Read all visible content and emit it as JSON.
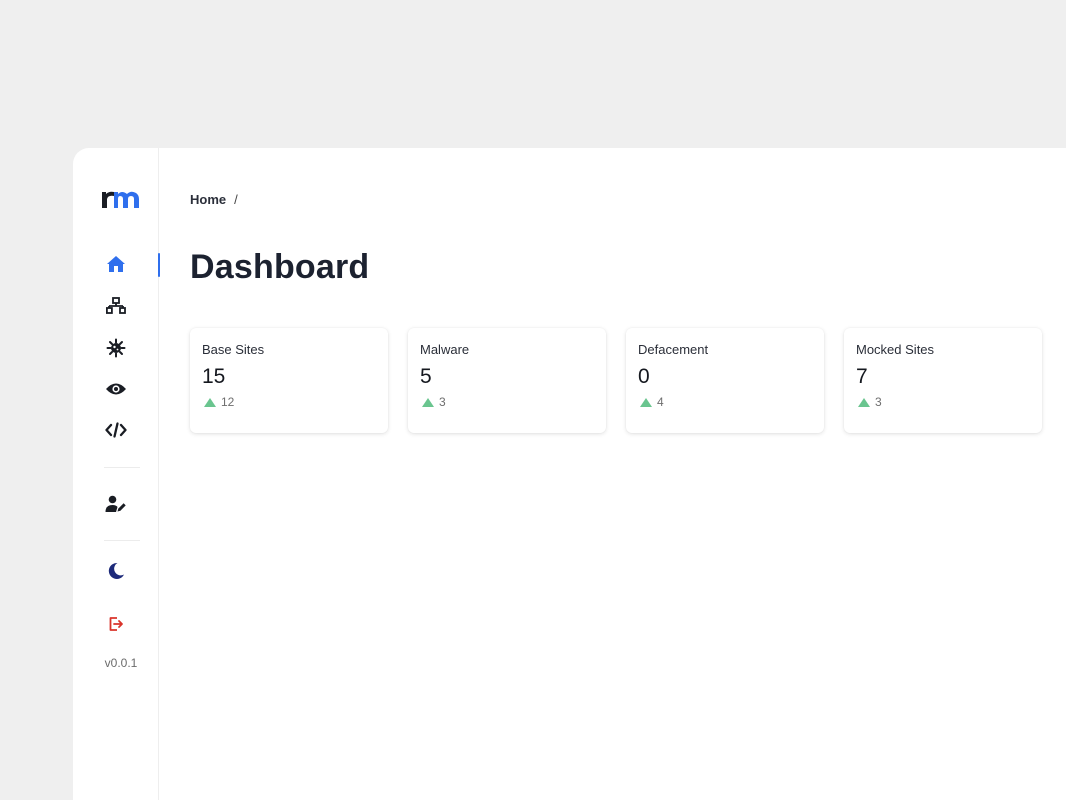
{
  "app": {
    "logo_text": "rm",
    "version": "v0.0.1"
  },
  "sidebar": {
    "items": [
      {
        "id": "home",
        "icon": "home-icon",
        "active": true
      },
      {
        "id": "network",
        "icon": "sitemap-icon",
        "active": false
      },
      {
        "id": "malware",
        "icon": "virus-icon",
        "active": false
      },
      {
        "id": "monitor",
        "icon": "eye-icon",
        "active": false
      },
      {
        "id": "code",
        "icon": "code-icon",
        "active": false
      },
      {
        "id": "user-edit",
        "icon": "user-edit-icon",
        "active": false
      },
      {
        "id": "theme",
        "icon": "moon-icon",
        "active": false
      },
      {
        "id": "logout",
        "icon": "logout-icon",
        "active": false
      }
    ]
  },
  "breadcrumb": {
    "items": [
      "Home"
    ],
    "separator": "/"
  },
  "page": {
    "title": "Dashboard"
  },
  "stats": [
    {
      "title": "Base Sites",
      "value": "15",
      "trend": "12"
    },
    {
      "title": "Malware",
      "value": "5",
      "trend": "3"
    },
    {
      "title": "Defacement",
      "value": "0",
      "trend": "4"
    },
    {
      "title": "Mocked Sites",
      "value": "7",
      "trend": "3"
    }
  ],
  "colors": {
    "accent": "#2f6fed",
    "trend_up": "#6ac58f",
    "logout": "#d9342b",
    "moon": "#1d2a7a",
    "icon": "#1a1d24"
  }
}
